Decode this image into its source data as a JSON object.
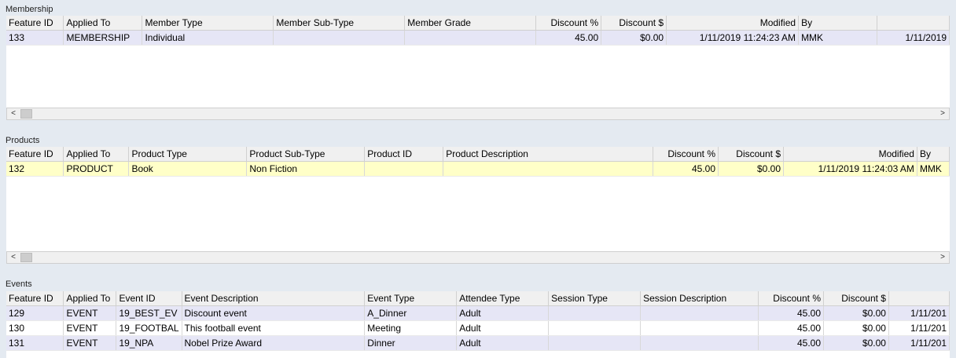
{
  "membership": {
    "title": "Membership",
    "columns": [
      "Feature ID",
      "Applied To",
      "Member Type",
      "Member Sub-Type",
      "Member Grade",
      "Discount %",
      "Discount $",
      "Modified",
      "By",
      ""
    ],
    "rows": [
      [
        "133",
        "MEMBERSHIP",
        "Individual",
        "",
        "",
        "45.00",
        "$0.00",
        "1/11/2019 11:24:23 AM",
        "MMK",
        "1/11/2019"
      ]
    ]
  },
  "products": {
    "title": "Products",
    "columns": [
      "Feature ID",
      "Applied To",
      "Product Type",
      "Product Sub-Type",
      "Product ID",
      "Product Description",
      "Discount %",
      "Discount $",
      "Modified",
      "By"
    ],
    "rows": [
      [
        "132",
        "PRODUCT",
        "Book",
        "Non Fiction",
        "",
        "",
        "45.00",
        "$0.00",
        "1/11/2019 11:24:03 AM",
        "MMK"
      ]
    ]
  },
  "events": {
    "title": "Events",
    "columns": [
      "Feature ID",
      "Applied To",
      "Event ID",
      "Event Description",
      "Event Type",
      "Attendee Type",
      "Session Type",
      "Session Description",
      "Discount %",
      "Discount $",
      ""
    ],
    "rows": [
      [
        "129",
        "EVENT",
        "19_BEST_EV",
        "Discount event",
        "A_Dinner",
        "Adult",
        "",
        "",
        "45.00",
        "$0.00",
        "1/11/201"
      ],
      [
        "130",
        "EVENT",
        "19_FOOTBAL",
        "This football event",
        "Meeting",
        "Adult",
        "",
        "",
        "45.00",
        "$0.00",
        "1/11/201"
      ],
      [
        "131",
        "EVENT",
        "19_NPA",
        "Nobel Prize Award",
        "Dinner",
        "Adult",
        "",
        "",
        "45.00",
        "$0.00",
        "1/11/201"
      ]
    ]
  },
  "scrollbar": {
    "left_arrow": "<",
    "right_arrow": ">"
  }
}
